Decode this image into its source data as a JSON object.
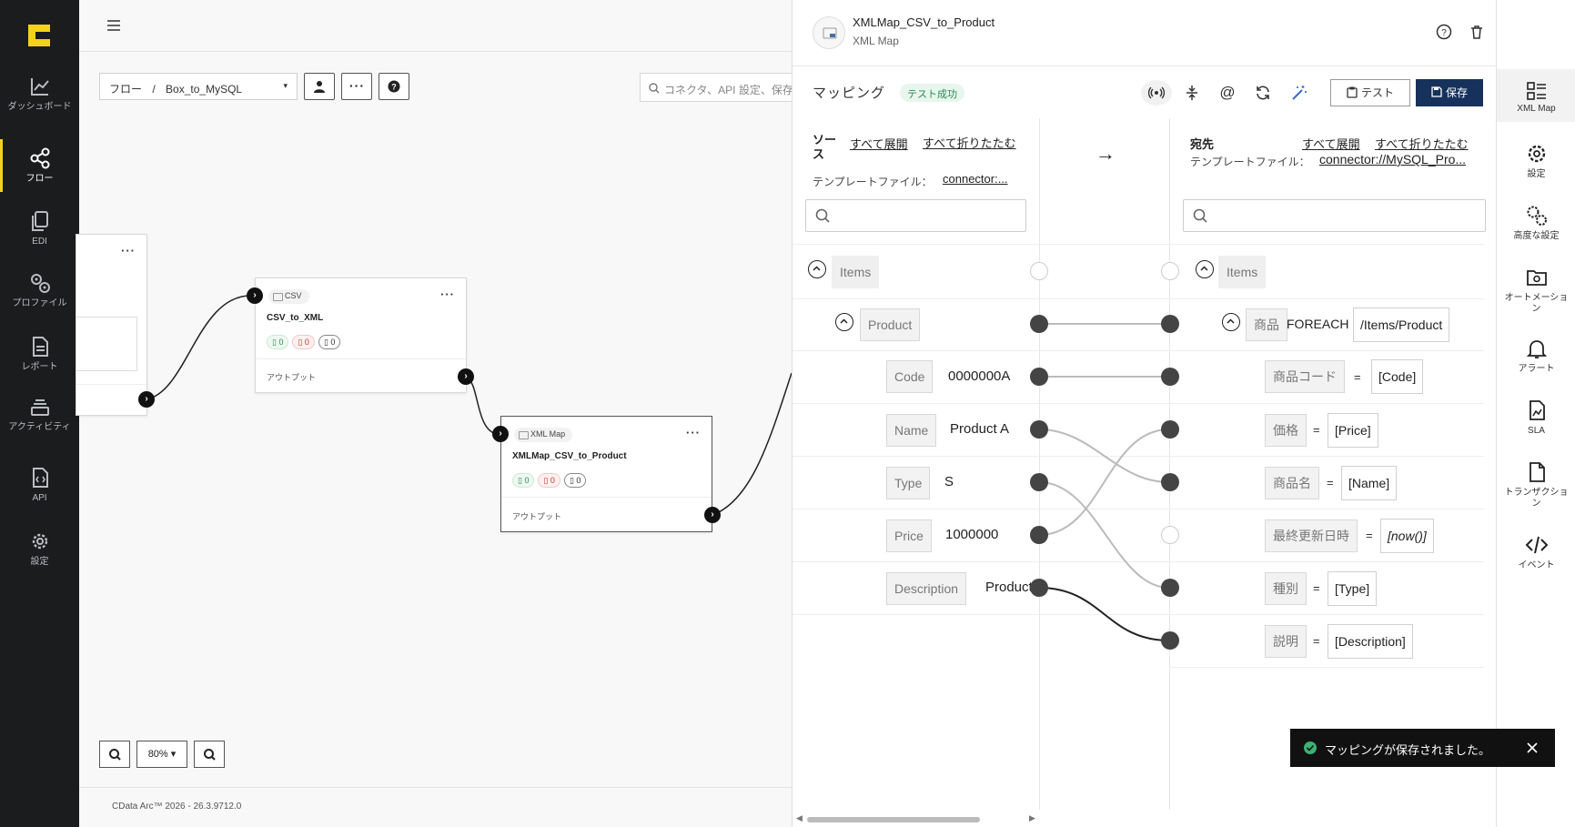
{
  "nav": {
    "items": [
      {
        "label": "ダッシュボード",
        "icon": "chart-line-icon"
      },
      {
        "label": "フロー",
        "icon": "share-nodes-icon"
      },
      {
        "label": "EDI",
        "icon": "documents-icon"
      },
      {
        "label": "プロファイル",
        "icon": "gears-icon"
      },
      {
        "label": "レポート",
        "icon": "report-icon"
      },
      {
        "label": "アクティビティ",
        "icon": "layers-icon"
      },
      {
        "label": "API",
        "icon": "api-file-icon"
      },
      {
        "label": "設定",
        "icon": "gear-icon"
      }
    ],
    "active": "フロー",
    "accent": "#f2d21b"
  },
  "canvas": {
    "breadcrumb_root": "フロー",
    "breadcrumb_sep": "/",
    "flow_name": "Box_to_MySQL",
    "search_placeholder": "コネクタ、API 設定、保存",
    "zoom": "80%",
    "footer": "CData Arc™ 2026 - 26.3.9712.0",
    "nodes": [
      {
        "tag": "CSV",
        "title": "CSV_to_XML",
        "green": "0",
        "red": "0",
        "black": "0",
        "output": "アウトプット"
      },
      {
        "tag": "XML Map",
        "title": "XMLMap_CSV_to_Product",
        "green": "0",
        "red": "0",
        "black": "0",
        "output": "アウトプット"
      }
    ]
  },
  "panel": {
    "title": "XMLMap_CSV_to_Product",
    "subtitle": "XML Map",
    "section": "マッピング",
    "status": "テスト成功",
    "test_label": "テスト",
    "save_label": "保存",
    "source": {
      "header": "ソース",
      "expand": "すべて展開",
      "collapse": "すべて折りたたむ",
      "template_label": "テンプレートファイル：",
      "template_value": "connector:...",
      "rows": [
        {
          "name": "Items",
          "value": ""
        },
        {
          "name": "Product",
          "value": ""
        },
        {
          "name": "Code",
          "value": "0000000A"
        },
        {
          "name": "Name",
          "value": "Product A"
        },
        {
          "name": "Type",
          "value": "S"
        },
        {
          "name": "Price",
          "value": "1000000"
        },
        {
          "name": "Description",
          "value": "Product"
        }
      ]
    },
    "arrow": "→",
    "dest": {
      "header": "宛先",
      "expand": "すべて展開",
      "collapse": "すべて折りたたむ",
      "template_label": "テンプレートファイル：",
      "template_value": "connector://MySQL_Pro...",
      "rows": [
        {
          "name": "Items",
          "expr": ""
        },
        {
          "name": "商品",
          "op": "FOREACH",
          "expr": "/Items/Product"
        },
        {
          "name": "商品コード",
          "op": "=",
          "expr": "[Code]"
        },
        {
          "name": "価格",
          "op": "=",
          "expr": "[Price]"
        },
        {
          "name": "商品名",
          "op": "=",
          "expr": "[Name]"
        },
        {
          "name": "最終更新日時",
          "op": "=",
          "expr": "[now()]"
        },
        {
          "name": "種別",
          "op": "=",
          "expr": "[Type]"
        },
        {
          "name": "説明",
          "op": "=",
          "expr": "[Description]"
        }
      ]
    }
  },
  "toast": {
    "message": "マッピングが保存されました。"
  },
  "sidemenu": {
    "items": [
      {
        "label": "XML Map",
        "icon": "grid-list-icon"
      },
      {
        "label": "設定",
        "icon": "gear-icon"
      },
      {
        "label": "高度な設定",
        "icon": "gears-icon"
      },
      {
        "label": "オートメーション",
        "icon": "folder-gear-icon"
      },
      {
        "label": "アラート",
        "icon": "bell-icon"
      },
      {
        "label": "SLA",
        "icon": "sla-icon"
      },
      {
        "label": "トランザクション",
        "icon": "file-icon"
      },
      {
        "label": "イベント",
        "icon": "code-icon"
      }
    ]
  },
  "colors": {
    "save_button": "#16325c",
    "status_green": "#2a8a52",
    "nav_bg": "#1b1c1e"
  }
}
